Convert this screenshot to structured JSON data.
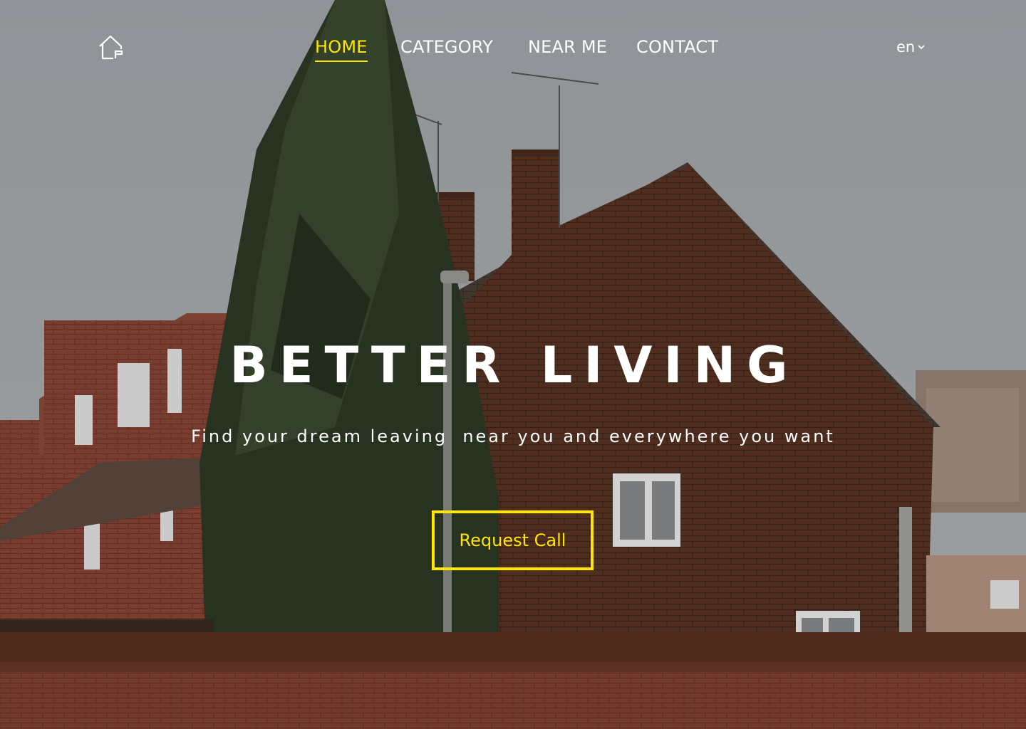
{
  "nav": {
    "items": [
      {
        "label": "HOME",
        "active": true
      },
      {
        "label": "CATEGORY",
        "active": false
      },
      {
        "label": "NEAR ME",
        "active": false
      },
      {
        "label": "CONTACT",
        "active": false
      }
    ],
    "language": "en",
    "logo_icon": "house-logo-icon",
    "language_icon": "chevron-down-icon"
  },
  "hero": {
    "title": "BETTER LIVING",
    "subtitle": "Find your dream leaving  near you and everywhere you want",
    "cta_label": "Request Call",
    "background": "photo-brick-houses-with-pine-tree"
  },
  "colors": {
    "accent": "#ffe600",
    "text": "#ffffff"
  }
}
